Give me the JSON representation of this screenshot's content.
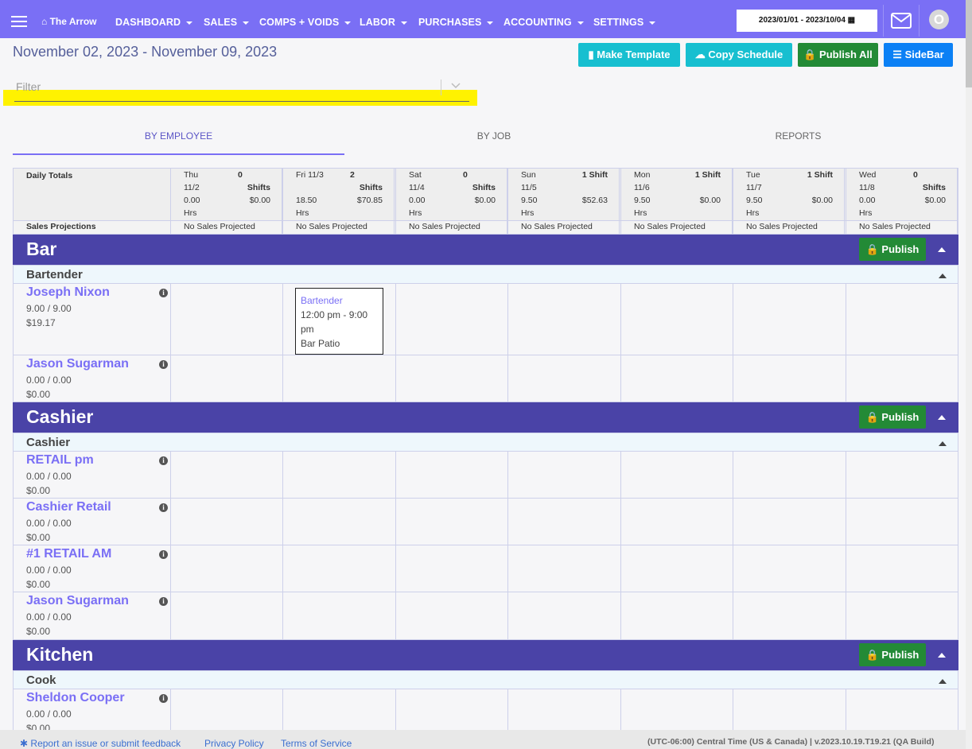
{
  "navbar": {
    "brand": "The Arrow",
    "items": [
      "DASHBOARD",
      "SALES",
      "COMPS + VOIDS",
      "LABOR",
      "PURCHASES",
      "ACCOUNTING",
      "SETTINGS"
    ],
    "date_range": "2023/01/01 - 2023/10/04",
    "avatar_letter": "O"
  },
  "header": {
    "date_title": "November 02, 2023 - November 09, 2023",
    "buttons": {
      "make_template": "Make Template",
      "copy_schedule": "Copy Schedule",
      "publish_all": "Publish All",
      "sidebar": "SideBar"
    },
    "filter_placeholder": "Filter"
  },
  "tabs": [
    "BY EMPLOYEE",
    "BY JOB",
    "REPORTS"
  ],
  "totals": {
    "label": "Daily Totals",
    "proj_label": "Sales Projections",
    "days": [
      {
        "day": "Thu",
        "date": "11/2",
        "shifts": "0",
        "shifts_label": "Shifts",
        "hrs": "0.00",
        "hrs_label": "Hrs",
        "amount": "$0.00",
        "proj": "No Sales Projected"
      },
      {
        "day": "Fri 11/3",
        "date": "",
        "shifts": "2",
        "shifts_label": "Shifts",
        "hrs": "18.50",
        "hrs_label": "Hrs",
        "amount": "$70.85",
        "proj": "No Sales Projected"
      },
      {
        "day": "Sat",
        "date": "11/4",
        "shifts": "0",
        "shifts_label": "Shifts",
        "hrs": "0.00",
        "hrs_label": "Hrs",
        "amount": "$0.00",
        "proj": "No Sales Projected"
      },
      {
        "day": "Sun",
        "date": "11/5",
        "shifts": "1 Shift",
        "shifts_label": "",
        "hrs": "9.50",
        "hrs_label": "Hrs",
        "amount": "$52.63",
        "proj": "No Sales Projected"
      },
      {
        "day": "Mon",
        "date": "11/6",
        "shifts": "1 Shift",
        "shifts_label": "",
        "hrs": "9.50",
        "hrs_label": "Hrs",
        "amount": "$0.00",
        "proj": "No Sales Projected"
      },
      {
        "day": "Tue",
        "date": "11/7",
        "shifts": "1 Shift",
        "shifts_label": "",
        "hrs": "9.50",
        "hrs_label": "Hrs",
        "amount": "$0.00",
        "proj": "No Sales Projected"
      },
      {
        "day": "Wed",
        "date": "11/8",
        "shifts": "0",
        "shifts_label": "Shifts",
        "hrs": "0.00",
        "hrs_label": "Hrs",
        "amount": "$0.00",
        "proj": "No Sales Projected"
      }
    ]
  },
  "departments": [
    {
      "name": "Bar",
      "publish": "Publish",
      "job": "Bartender",
      "employees": [
        {
          "name": "Joseph Nixon",
          "hours": "9.00 / 9.00",
          "cost": "$19.17"
        },
        {
          "name": "Jason Sugarman",
          "hours": "0.00 / 0.00",
          "cost": "$0.00"
        }
      ]
    },
    {
      "name": "Cashier",
      "publish": "Publish",
      "job": "Cashier",
      "employees": [
        {
          "name": "RETAIL pm",
          "hours": "0.00 / 0.00",
          "cost": "$0.00"
        },
        {
          "name": "Cashier Retail",
          "hours": "0.00 / 0.00",
          "cost": "$0.00"
        },
        {
          "name": "#1 RETAIL AM",
          "hours": "0.00 / 0.00",
          "cost": "$0.00"
        },
        {
          "name": "Jason Sugarman",
          "hours": "0.00 / 0.00",
          "cost": "$0.00"
        }
      ]
    },
    {
      "name": "Kitchen",
      "publish": "Publish",
      "job": "Cook",
      "employees": [
        {
          "name": "Sheldon Cooper",
          "hours": "0.00 / 0.00",
          "cost": "$0.00"
        }
      ]
    }
  ],
  "shift": {
    "job": "Bartender",
    "time": "12:00 pm - 9:00 pm",
    "location": "Bar Patio"
  },
  "footer": {
    "report": "Report an issue or submit feedback",
    "privacy": "Privacy Policy",
    "terms": "Terms of Service",
    "right": "(UTC-06:00) Central Time (US & Canada) | v.2023.10.19.T19.21 (QA Build)"
  },
  "colors": {
    "nav": "#7a6ff5",
    "dept": "#4a43a7",
    "publish": "#238a36",
    "teal": "#17bfd0",
    "blue": "#0b80f5"
  }
}
